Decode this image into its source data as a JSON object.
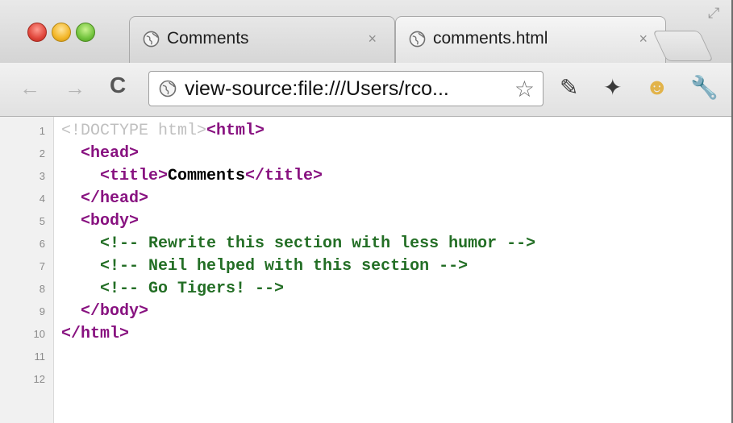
{
  "tabs": [
    {
      "label": "Comments",
      "close": "×",
      "active": false
    },
    {
      "label": "comments.html",
      "close": "×",
      "active": true
    }
  ],
  "toolbar": {
    "back_icon": "←",
    "forward_icon": "→",
    "reload_icon": "C",
    "url": "view-source:file:///Users/rco...",
    "bookmark_star": "☆"
  },
  "source_lines": [
    {
      "num": "1",
      "indent": "",
      "parts": [
        {
          "t": "<!DOCTYPE html>",
          "c": "doctype"
        },
        {
          "t": "<html>",
          "c": "tag"
        }
      ]
    },
    {
      "num": "2",
      "indent": "  ",
      "parts": [
        {
          "t": "<head>",
          "c": "tag"
        }
      ]
    },
    {
      "num": "3",
      "indent": "    ",
      "parts": [
        {
          "t": "<title>",
          "c": "tag"
        },
        {
          "t": "Comments",
          "c": "text"
        },
        {
          "t": "</title>",
          "c": "tag"
        }
      ]
    },
    {
      "num": "4",
      "indent": "  ",
      "parts": [
        {
          "t": "</head>",
          "c": "tag"
        }
      ]
    },
    {
      "num": "5",
      "indent": "  ",
      "parts": [
        {
          "t": "<body>",
          "c": "tag"
        }
      ]
    },
    {
      "num": "6",
      "indent": "    ",
      "parts": [
        {
          "t": "<!-- Rewrite this section with less humor -->",
          "c": "comment"
        }
      ]
    },
    {
      "num": "7",
      "indent": "    ",
      "parts": [
        {
          "t": "<!-- Neil helped with this section -->",
          "c": "comment"
        }
      ]
    },
    {
      "num": "8",
      "indent": "    ",
      "parts": [
        {
          "t": "<!-- Go Tigers! -->",
          "c": "comment"
        }
      ]
    },
    {
      "num": "9",
      "indent": "  ",
      "parts": [
        {
          "t": "</body>",
          "c": "tag"
        }
      ]
    },
    {
      "num": "10",
      "indent": "",
      "parts": [
        {
          "t": "</html>",
          "c": "tag"
        }
      ]
    },
    {
      "num": "11",
      "indent": "",
      "parts": []
    },
    {
      "num": "12",
      "indent": "",
      "parts": []
    }
  ],
  "colors": {
    "tag": "#881280",
    "comment": "#236e25",
    "doctype": "#c0c0c0",
    "text": "#000000"
  }
}
